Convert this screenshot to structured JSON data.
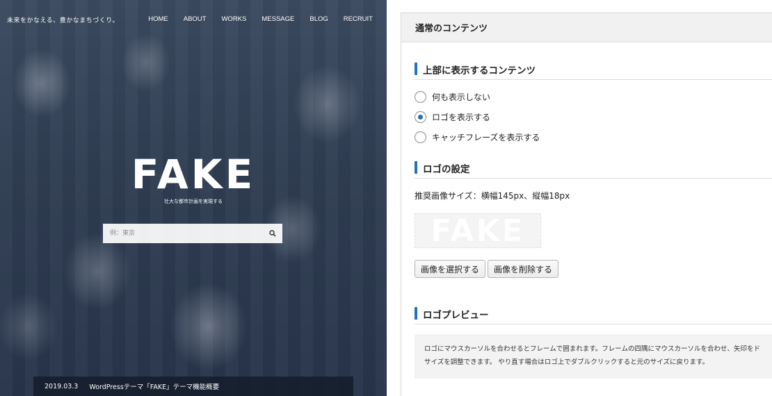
{
  "preview": {
    "tagline": "未来をかなえる、豊かなまちづくり。",
    "nav": [
      "HOME",
      "ABOUT",
      "WORKS",
      "MESSAGE",
      "BLOG",
      "RECRUIT"
    ],
    "logo": "FAKE",
    "logo_sub": "壮大な都市計画を実現する",
    "search_placeholder": "例：東京",
    "news_date": "2019.03.3",
    "news_title": "WordPressテーマ「FAKE」テーマ機能概要"
  },
  "panel": {
    "title": "通常のコンテンツ",
    "top_section": {
      "heading": "上部に表示するコンテンツ",
      "options": [
        {
          "label": "何も表示しない",
          "checked": false
        },
        {
          "label": "ロゴを表示する",
          "checked": true
        },
        {
          "label": "キャッチフレーズを表示する",
          "checked": false
        }
      ]
    },
    "logo_section": {
      "heading": "ロゴの設定",
      "recommended_size": "推奨画像サイズ：横幅145px、縦幅18px",
      "logo_text": "FAKE",
      "select_button": "画像を選択する",
      "delete_button": "画像を削除する"
    },
    "preview_section": {
      "heading": "ロゴプレビュー",
      "note_line1": "ロゴにマウスカーソルを合わせるとフレームで囲まれます。フレームの四隅にマウスカーソルを合わせ、矢印をド",
      "note_line2": "サイズを調整できます。 やり直す場合はロゴ上でダブルクリックすると元のサイズに戻ります。"
    }
  },
  "colors": {
    "accent": "#1e73be",
    "radio_checked": "#2271b1",
    "hero_overlay": "#2f3d52"
  }
}
